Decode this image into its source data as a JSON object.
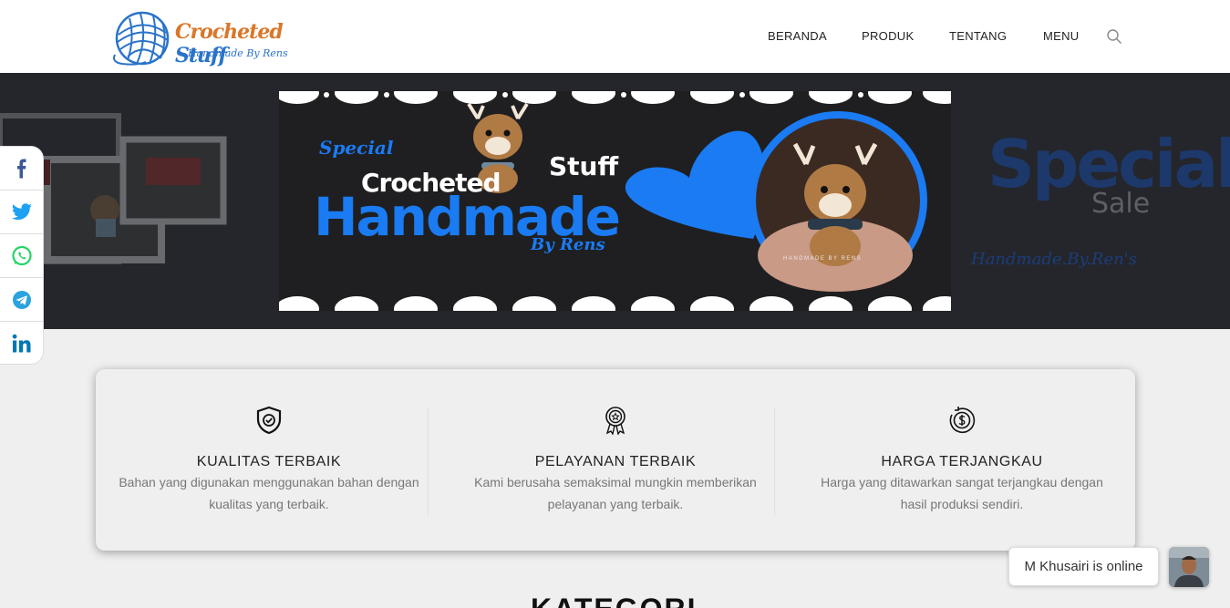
{
  "logo": {
    "title_part1": "Crocheted",
    "title_part2": "Stuff",
    "tagline": "Handmade By Rens"
  },
  "nav": {
    "items": [
      {
        "label": "BERANDA"
      },
      {
        "label": "PRODUK"
      },
      {
        "label": "TENTANG"
      },
      {
        "label": "MENU"
      }
    ],
    "search_icon": "search-icon"
  },
  "banner": {
    "special": "Special",
    "crocheted": "Crocheted",
    "stuff": "Stuff",
    "handmade": "Handmade",
    "by_rens": "By Rens",
    "photo_caption": "HANDMADE BY RENS",
    "right_special": "Special",
    "right_sale": "Sale",
    "right_tag": "Handmade.By.Ren's",
    "accent_color": "#1a7bf2"
  },
  "share": {
    "items": [
      {
        "icon": "facebook-icon",
        "color": "#3b5998"
      },
      {
        "icon": "twitter-icon",
        "color": "#1da1f2"
      },
      {
        "icon": "whatsapp-icon",
        "color": "#25d366"
      },
      {
        "icon": "telegram-icon",
        "color": "#2aa3df"
      },
      {
        "icon": "linkedin-icon",
        "color": "#0077b5"
      }
    ]
  },
  "features": [
    {
      "icon": "shield-check-icon",
      "title": "KUALITAS TERBAIK",
      "desc": "Bahan yang digunakan menggunakan bahan dengan kualitas yang terbaik."
    },
    {
      "icon": "award-badge-icon",
      "title": "PELAYANAN TERBAIK",
      "desc": "Kami berusaha semaksimal mungkin memberikan pelayanan yang terbaik."
    },
    {
      "icon": "dollar-coin-icon",
      "title": "HARGA TERJANGKAU",
      "desc": "Harga yang ditawarkan sangat terjangkau dengan hasil produksi sendiri."
    }
  ],
  "section": {
    "kategori_heading": "KATEGORI"
  },
  "chat": {
    "status_text": "M Khusairi is online"
  }
}
